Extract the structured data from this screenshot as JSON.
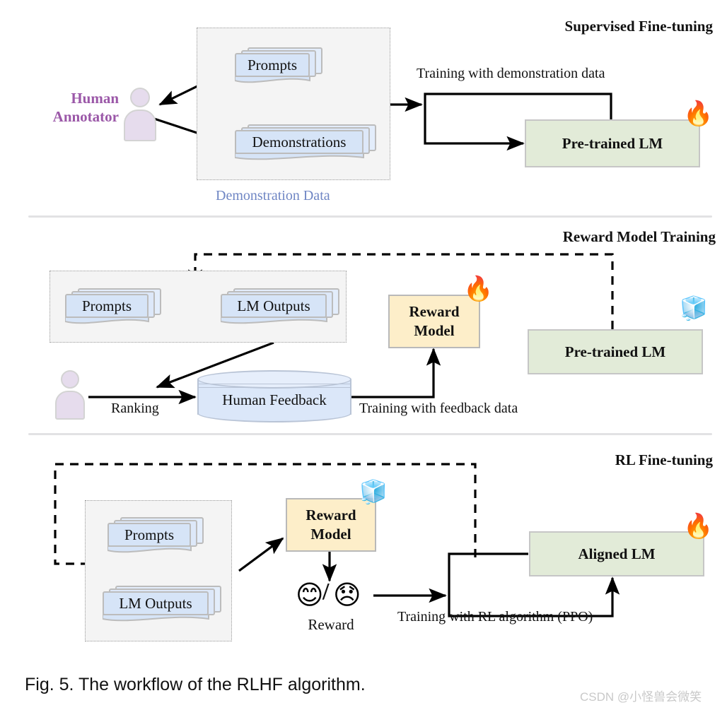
{
  "figure": {
    "caption": "Fig. 5. The workflow of the RLHF algorithm.",
    "watermark": "CSDN @小怪兽会微笑"
  },
  "colors": {
    "lm_box": "#e2ebd8",
    "reward_box": "#fdeec9",
    "document": "#d6e4f7",
    "person": "#e6dced",
    "annotator_text": "#9b58a8",
    "group_label": "#6f86c4",
    "divider": "#e2e2e4"
  },
  "sections": [
    {
      "id": "supervised-fine-tuning",
      "title": "Supervised Fine-tuning",
      "group_label": "Demonstration Data",
      "annotator": "Human\nAnnotator",
      "annotator_line1": "Human",
      "annotator_line2": "Annotator",
      "documents": [
        "Prompts",
        "Demonstrations"
      ],
      "model_box": "Pre-trained LM",
      "model_state_icon": "fire",
      "model_state_emoji": "🔥",
      "edge_label": "Training with demonstration data"
    },
    {
      "id": "reward-model-training",
      "title": "Reward Model Training",
      "documents": [
        "Prompts",
        "LM Outputs"
      ],
      "reward_box_line1": "Reward",
      "reward_box_line2": "Model",
      "reward_state_icon": "fire",
      "reward_state_emoji": "🔥",
      "model_box": "Pre-trained LM",
      "model_state_icon": "ice",
      "model_state_emoji": "🧊",
      "database": "Human Feedback",
      "edge_label_ranking": "Ranking",
      "edge_label_training": "Training with feedback data"
    },
    {
      "id": "rl-fine-tuning",
      "title": "RL Fine-tuning",
      "documents": [
        "Prompts",
        "LM Outputs"
      ],
      "reward_box_line1": "Reward",
      "reward_box_line2": "Model",
      "reward_state_icon": "ice",
      "reward_state_emoji": "🧊",
      "reward_caption": "Reward",
      "reward_positive_emoji": "😊",
      "reward_separator": "/",
      "reward_negative_emoji": "😞",
      "model_box": "Aligned LM",
      "model_state_icon": "fire",
      "model_state_emoji": "🔥",
      "edge_label": "Training with RL algorithm (PPO)"
    }
  ]
}
